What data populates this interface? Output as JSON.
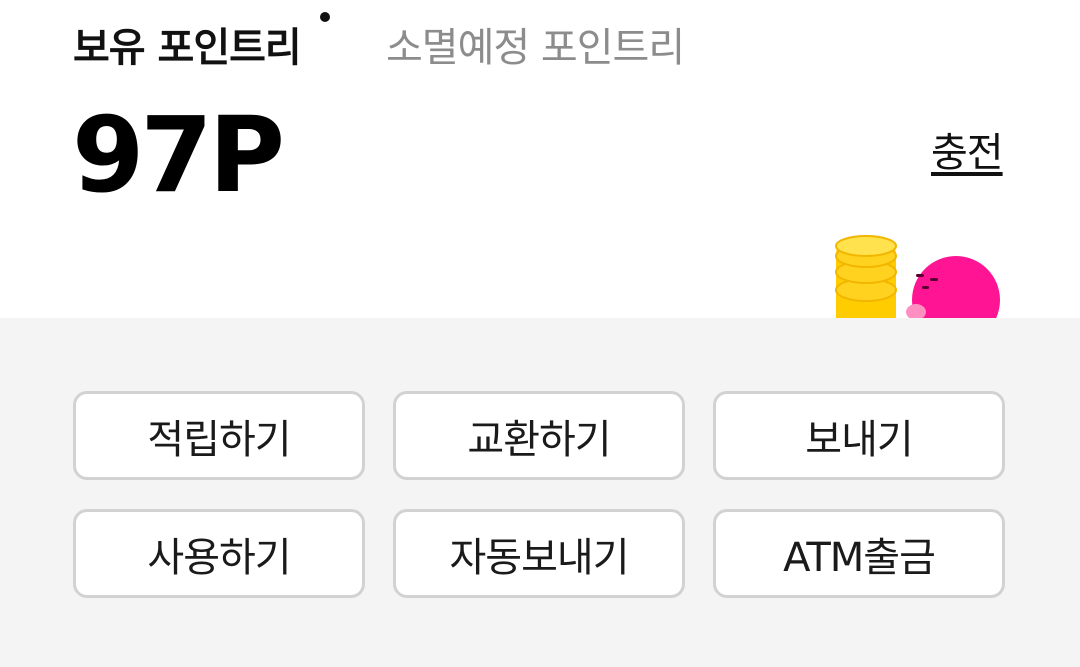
{
  "tabs": {
    "held_label": "보유 포인트리",
    "expiring_label": "소멸예정 포인트리"
  },
  "balance": {
    "points": "97P"
  },
  "charge_link": "충전",
  "actions": [
    "적립하기",
    "교환하기",
    "보내기",
    "사용하기",
    "자동보내기",
    "ATM출금"
  ],
  "icons": {
    "mascot": "coin-mascot-icon",
    "selected_indicator": "dot-icon"
  },
  "colors": {
    "mascot_pink": "#ff1493",
    "coin_yellow": "#ffd21f",
    "panel_bg": "#f4f4f4",
    "button_border": "#d2d2d2"
  }
}
